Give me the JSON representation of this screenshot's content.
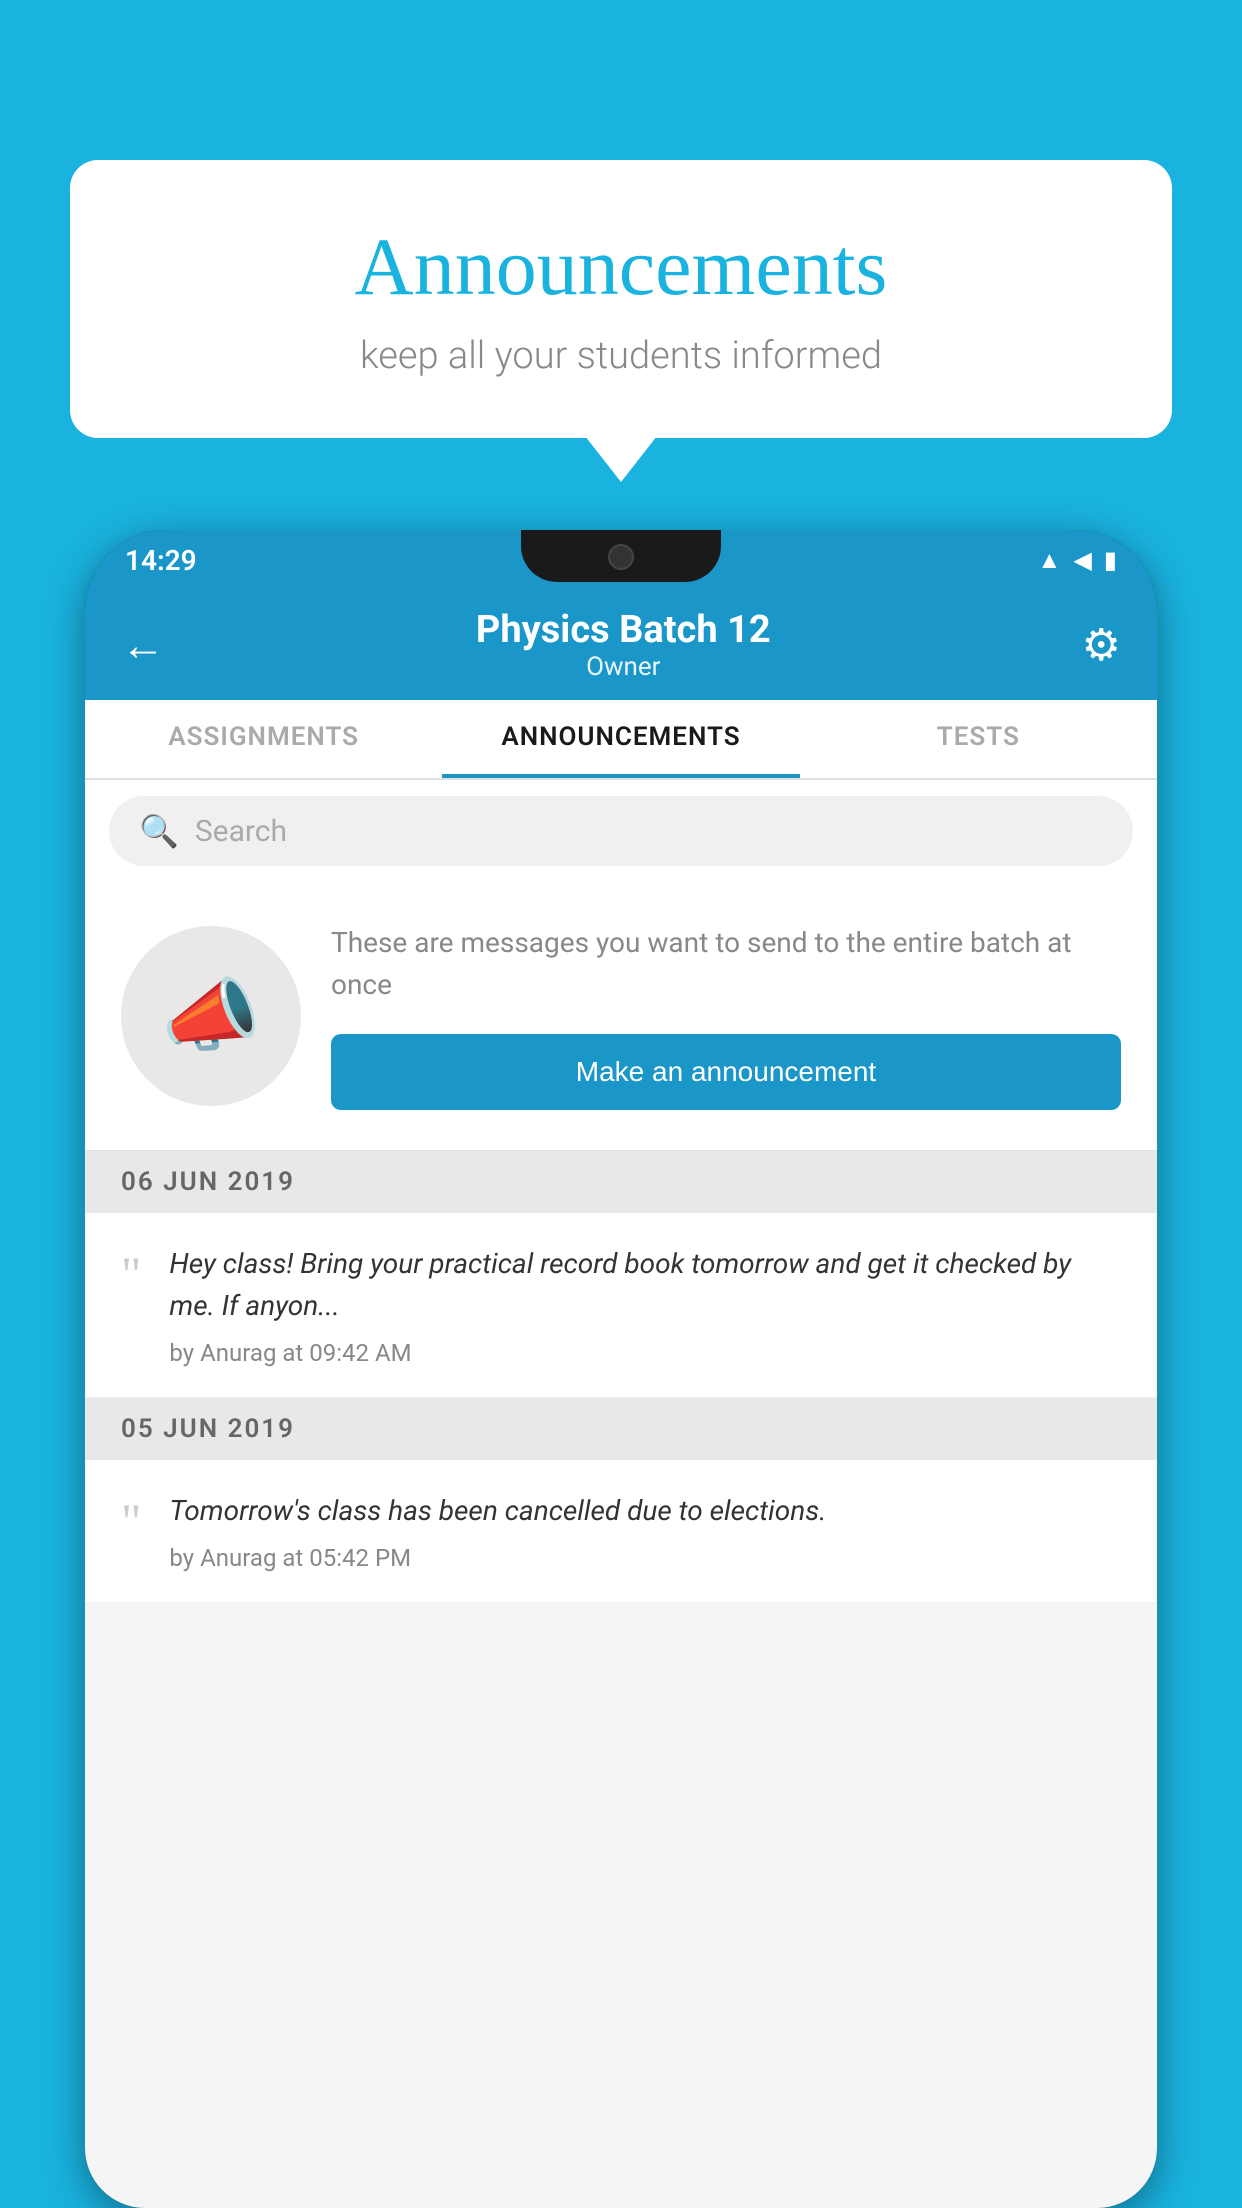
{
  "background": {
    "color": "#1ab3e0"
  },
  "speech_bubble": {
    "title": "Announcements",
    "subtitle": "keep all your students informed"
  },
  "phone": {
    "status_bar": {
      "time": "14:29",
      "icons": [
        "wifi",
        "signal",
        "battery"
      ]
    },
    "app_bar": {
      "title": "Physics Batch 12",
      "subtitle": "Owner",
      "back_label": "←",
      "settings_label": "⚙"
    },
    "tabs": [
      {
        "label": "ASSIGNMENTS",
        "active": false
      },
      {
        "label": "ANNOUNCEMENTS",
        "active": true
      },
      {
        "label": "TESTS",
        "active": false
      }
    ],
    "search": {
      "placeholder": "Search"
    },
    "promo": {
      "description": "These are messages you want to send to the entire batch at once",
      "button_label": "Make an announcement"
    },
    "announcements": [
      {
        "date": "06  JUN  2019",
        "text": "Hey class! Bring your practical record book tomorrow and get it checked by me. If anyon...",
        "meta": "by Anurag at 09:42 AM"
      },
      {
        "date": "05  JUN  2019",
        "text": "Tomorrow's class has been cancelled due to elections.",
        "meta": "by Anurag at 05:42 PM"
      }
    ]
  }
}
